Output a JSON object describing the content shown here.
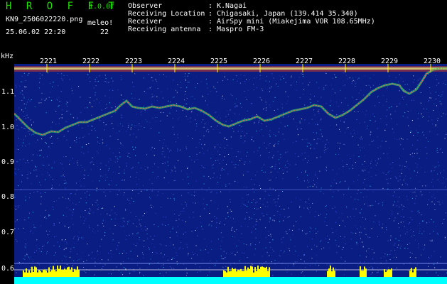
{
  "header": {
    "brand": "H R O F F T",
    "fps": "1.0.0f",
    "filename": "KN9_2506022220.png",
    "meteor_label": "meleo!",
    "datetime": "25.06.02 22:20",
    "meteor_count": "22"
  },
  "meta": [
    {
      "key": "Observer",
      "value": "K.Nagai"
    },
    {
      "key": "Receiving Location",
      "value": "Chigasaki, Japan (139.414 35.340)"
    },
    {
      "key": "Receiver",
      "value": "AirSpy mini (Miakejima VOR 108.65MHz)"
    },
    {
      "key": "Receiving antenna",
      "value": "Maspro FM-3"
    }
  ],
  "axis": {
    "unit": "kHz",
    "y_labels": [
      "1.1",
      "1.0",
      "0.9",
      "0.8",
      "0.7",
      "0.6"
    ],
    "time_labels": [
      "2221",
      "2222",
      "2223",
      "2224",
      "2225",
      "2226",
      "2227",
      "2228",
      "2229",
      "2230"
    ]
  },
  "colors": {
    "brand": "#22e000",
    "background": "#0a1d82",
    "tick_band": "#ffff00",
    "bottom_band": "#00ffff"
  }
}
